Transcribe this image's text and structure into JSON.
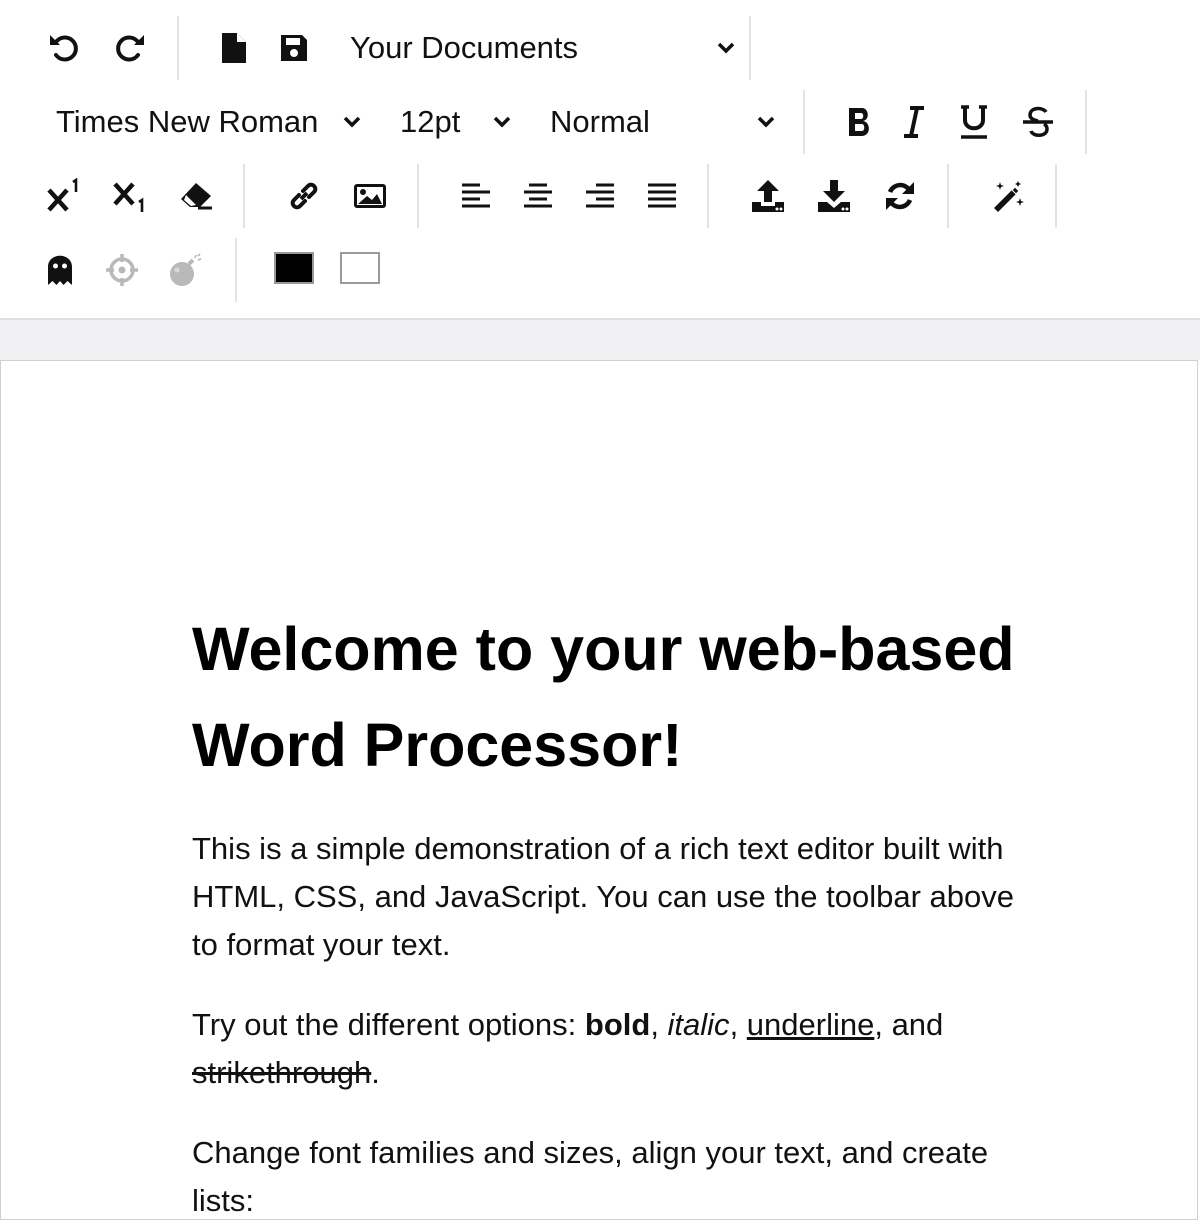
{
  "toolbar": {
    "document_select": {
      "value": "Your Documents"
    },
    "font_family": {
      "value": "Times New Roman"
    },
    "font_size": {
      "value": "12pt"
    },
    "block_format": {
      "value": "Normal"
    },
    "buttons": {
      "undo": "undo-icon",
      "redo": "redo-icon",
      "new_document": "file-icon",
      "save": "floppy-disk-icon",
      "bold": "bold-icon",
      "italic": "italic-icon",
      "underline": "underline-icon",
      "strikethrough": "strikethrough-icon",
      "superscript": "superscript-icon",
      "subscript": "subscript-icon",
      "clear_format": "eraser-icon",
      "link": "link-icon",
      "image": "image-icon",
      "align_left": "align-left-icon",
      "align_center": "align-center-icon",
      "align_right": "align-right-icon",
      "justify": "align-justify-icon",
      "upload": "upload-icon",
      "download": "download-icon",
      "refresh": "sync-icon",
      "magic": "magic-wand-icon",
      "ghost": "ghost-icon",
      "target": "crosshairs-icon",
      "bomb": "bomb-icon"
    },
    "text_color": "#000000",
    "background_color": "#ffffff"
  },
  "document": {
    "heading": "Welcome to your web-based Word Processor!",
    "paragraph1": "This is a simple demonstration of a rich text editor built with HTML, CSS, and JavaScript. You can use the toolbar above to format your text.",
    "paragraph2": {
      "intro": "Try out the different options: ",
      "bold": "bold",
      "sep1": ", ",
      "italic": "italic",
      "sep2": ", ",
      "underline": "underline",
      "sep3": ", and",
      "strikethrough": "strikethrough",
      "end": "."
    },
    "paragraph3": "Change font families and sizes, align your text, and create lists:"
  }
}
